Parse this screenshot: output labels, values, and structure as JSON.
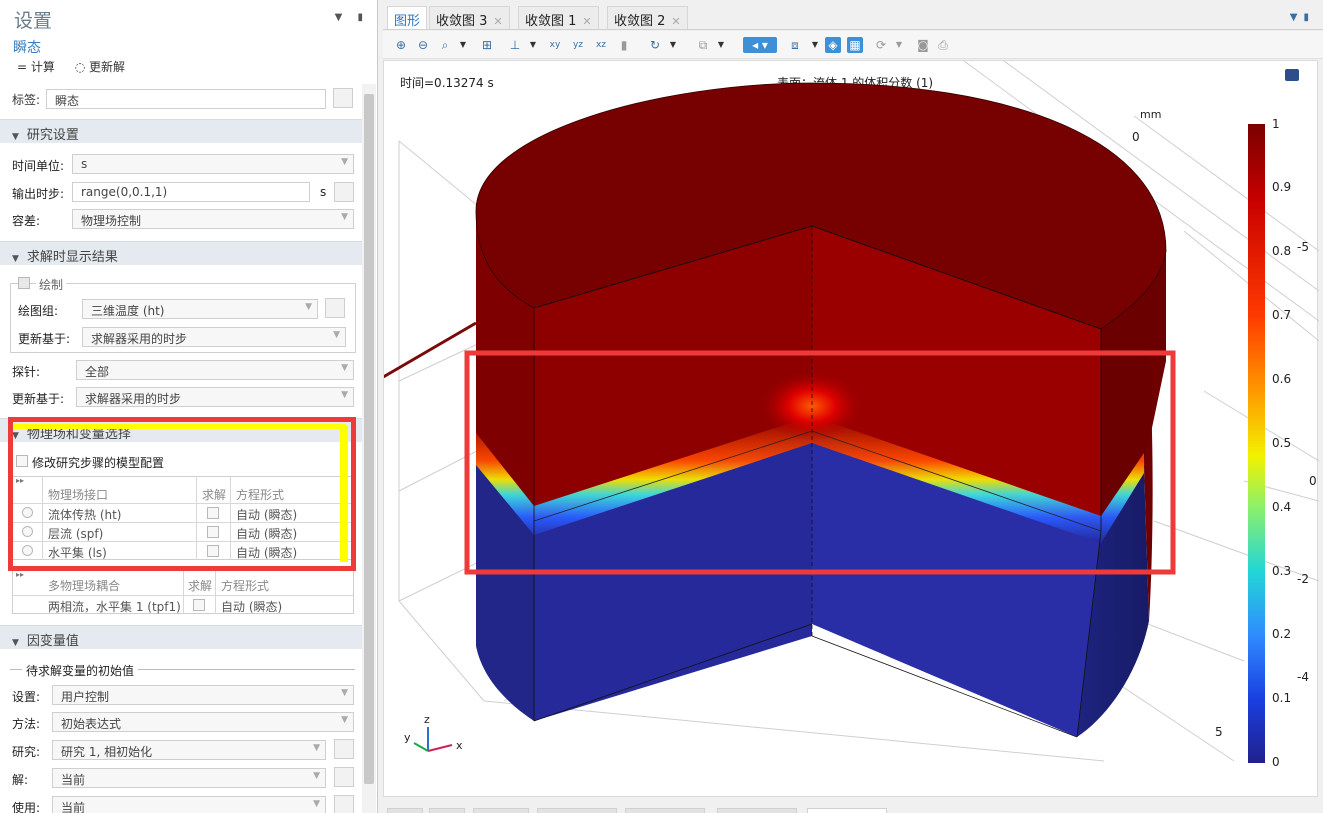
{
  "settings": {
    "title": "设置",
    "subtitle": "瞬态",
    "compute": "计算",
    "update_solution": "更新解",
    "tag_label": "标签:",
    "tag_value": "瞬态",
    "study_settings": {
      "heading": "研究设置",
      "time_unit_label": "时间单位:",
      "time_unit_value": "s",
      "output_steps_label": "输出时步:",
      "output_steps_value": "range(0,0.1,1)",
      "output_steps_unit": "s",
      "tolerance_label": "容差:",
      "tolerance_value": "物理场控制"
    },
    "results_while_solving": {
      "heading": "求解时显示结果",
      "plot_label": "绘制",
      "plot_group_label": "绘图组:",
      "plot_group_value": "三维温度 (ht)",
      "update_at_label": "更新基于:",
      "update_at_value": "求解器采用的时步",
      "probes_label": "探针:",
      "probes_value": "全部",
      "probes_update_label": "更新基于:",
      "probes_update_value": "求解器采用的时步"
    },
    "physics_selection": {
      "heading": "物理场和变量选择",
      "modify_config": "修改研究步骤的模型配置",
      "columns": [
        "物理场接口",
        "求解",
        "方程形式"
      ],
      "rows": [
        {
          "name": "流体传热 (ht)",
          "form": "自动 (瞬态)"
        },
        {
          "name": "层流 (spf)",
          "form": "自动 (瞬态)"
        },
        {
          "name": "水平集 (ls)",
          "form": "自动 (瞬态)"
        }
      ],
      "multi_columns": [
        "多物理场耦合",
        "求解",
        "方程形式"
      ],
      "multi_rows": [
        {
          "name": "两相流，水平集 1 (tpf1)",
          "form": "自动 (瞬态)"
        }
      ]
    },
    "dependent_values": {
      "heading": "因变量值",
      "initial_values_heading": "待求解变量的初始值",
      "setting_label": "设置:",
      "setting_value": "用户控制",
      "method_label": "方法:",
      "method_value": "初始表达式",
      "study_label": "研究:",
      "study_value": "研究 1, 相初始化",
      "solution_label": "解:",
      "solution_value": "当前",
      "use_label": "使用:",
      "use_value": "当前"
    }
  },
  "graphics": {
    "tabs": [
      "图形",
      "收敛图 3",
      "收敛图 1",
      "收敛图 2"
    ],
    "time_label": "时间=0.13274 s",
    "surface_label": "表面：流体 1 的体积分数 (1)",
    "axis_unit": "mm",
    "axis_ticks": [
      "0",
      "-5",
      "0",
      "-2",
      "-4",
      "5"
    ],
    "triad": {
      "x": "x",
      "y": "y",
      "z": "z"
    }
  },
  "colorbar": {
    "ticks": [
      "1",
      "0.9",
      "0.8",
      "0.7",
      "0.6",
      "0.5",
      "0.4",
      "0.3",
      "0.2",
      "0.1",
      "0"
    ],
    "colors": [
      "#7a0000",
      "#c80000",
      "#ff3a00",
      "#ff9a00",
      "#f2f200",
      "#8cf06a",
      "#22d6d6",
      "#2f8cff",
      "#1a3fe0",
      "#20208c"
    ]
  },
  "colors": {
    "accent_tab": "#2a74c0",
    "annotation_red": "#ef3a3a",
    "annotation_yellow": "#ffff00",
    "arrow": "#7a0a0a",
    "fluid1": "#7d0000",
    "fluid2": "#21268f"
  }
}
